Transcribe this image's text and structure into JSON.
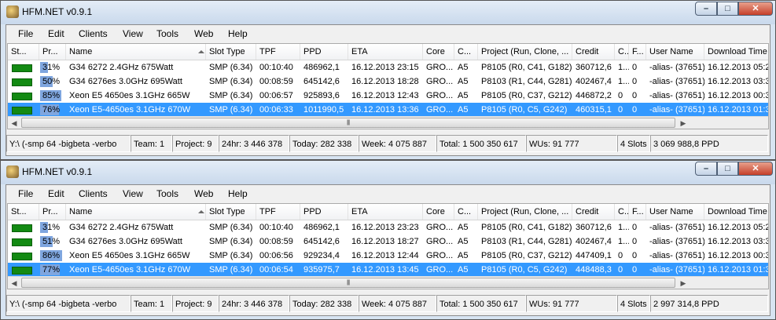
{
  "windows": [
    {
      "title": "HFM.NET v0.9.1",
      "menu": [
        "File",
        "Edit",
        "Clients",
        "View",
        "Tools",
        "Web",
        "Help"
      ],
      "columns": [
        "St...",
        "Pr...",
        "Name",
        "Slot Type",
        "TPF",
        "PPD",
        "ETA",
        "Core",
        "C...",
        "Project (Run, Clone, ...",
        "Credit",
        "C...",
        "F...",
        "User Name",
        "Download Time"
      ],
      "rows": [
        {
          "status": "running",
          "progress": 31,
          "progress_text": "31%",
          "name": "G34 6272 2.4GHz 675Watt",
          "slot_type": "SMP (6.34)",
          "tpf": "00:10:40",
          "ppd": "486962,1",
          "eta": "16.12.2013 23:15",
          "core": "GRO...",
          "c": "A5",
          "project": "P8105 (R0, C41, G182)",
          "credit": "360712,6",
          "c2": "1...",
          "f": "0",
          "user": "-alias- (37651)",
          "download": "16.12.2013 05:27",
          "selected": false
        },
        {
          "status": "running",
          "progress": 50,
          "progress_text": "50%",
          "name": "G34 6276es 3.0GHz 695Watt",
          "slot_type": "SMP (6.34)",
          "tpf": "00:08:59",
          "ppd": "645142,6",
          "eta": "16.12.2013 18:28",
          "core": "GRO...",
          "c": "A5",
          "project": "P8103 (R1, C44, G281)",
          "credit": "402467,4",
          "c2": "1...",
          "f": "0",
          "user": "-alias- (37651)",
          "download": "16.12.2013 03:31",
          "selected": false
        },
        {
          "status": "running",
          "progress": 85,
          "progress_text": "85%",
          "name": "Xeon E5 4650es 3.1GHz 665W",
          "slot_type": "SMP (6.34)",
          "tpf": "00:06:57",
          "ppd": "925893,6",
          "eta": "16.12.2013 12:43",
          "core": "GRO...",
          "c": "A5",
          "project": "P8105 (R0, C37, G212)",
          "credit": "446872,2",
          "c2": "0",
          "f": "0",
          "user": "-alias- (37651)",
          "download": "16.12.2013 00:34",
          "selected": false
        },
        {
          "status": "running",
          "progress": 76,
          "progress_text": "76%",
          "name": "Xeon E5-4650es 3.1GHz 670W",
          "slot_type": "SMP (6.34)",
          "tpf": "00:06:33",
          "ppd": "1011990,5",
          "eta": "16.12.2013 13:36",
          "core": "GRO...",
          "c": "A5",
          "project": "P8105 (R0, C5, G242)",
          "credit": "460315,1",
          "c2": "0",
          "f": "0",
          "user": "-alias- (37651)",
          "download": "16.12.2013 01:39",
          "selected": true
        }
      ],
      "status": {
        "path": "Y:\\ (-smp 64 -bigbeta -verbo",
        "team": "Team: 1",
        "project": "Project: 9",
        "h24": "24hr: 3 446 378",
        "today": "Today: 282 338",
        "week": "Week: 4 075 887",
        "total": "Total: 1 500 350 617",
        "wus": "WUs: 91 777",
        "slots": "4 Slots",
        "ppd": "3 069 988,8 PPD"
      }
    },
    {
      "title": "HFM.NET v0.9.1",
      "menu": [
        "File",
        "Edit",
        "Clients",
        "View",
        "Tools",
        "Web",
        "Help"
      ],
      "columns": [
        "St...",
        "Pr...",
        "Name",
        "Slot Type",
        "TPF",
        "PPD",
        "ETA",
        "Core",
        "C...",
        "Project (Run, Clone, ...",
        "Credit",
        "C...",
        "F...",
        "User Name",
        "Download Time"
      ],
      "rows": [
        {
          "status": "running",
          "progress": 31,
          "progress_text": "31%",
          "name": "G34 6272 2.4GHz 675Watt",
          "slot_type": "SMP (6.34)",
          "tpf": "00:10:40",
          "ppd": "486962,1",
          "eta": "16.12.2013 23:23",
          "core": "GRO...",
          "c": "A5",
          "project": "P8105 (R0, C41, G182)",
          "credit": "360712,6",
          "c2": "1...",
          "f": "0",
          "user": "-alias- (37651)",
          "download": "16.12.2013 05:27",
          "selected": false
        },
        {
          "status": "running",
          "progress": 51,
          "progress_text": "51%",
          "name": "G34 6276es 3.0GHz 695Watt",
          "slot_type": "SMP (6.34)",
          "tpf": "00:08:59",
          "ppd": "645142,6",
          "eta": "16.12.2013 18:27",
          "core": "GRO...",
          "c": "A5",
          "project": "P8103 (R1, C44, G281)",
          "credit": "402467,4",
          "c2": "1...",
          "f": "0",
          "user": "-alias- (37651)",
          "download": "16.12.2013 03:31",
          "selected": false
        },
        {
          "status": "running",
          "progress": 86,
          "progress_text": "86%",
          "name": "Xeon E5 4650es 3.1GHz 665W",
          "slot_type": "SMP (6.34)",
          "tpf": "00:06:56",
          "ppd": "929234,4",
          "eta": "16.12.2013 12:44",
          "core": "GRO...",
          "c": "A5",
          "project": "P8105 (R0, C37, G212)",
          "credit": "447409,1",
          "c2": "0",
          "f": "0",
          "user": "-alias- (37651)",
          "download": "16.12.2013 00:34",
          "selected": false
        },
        {
          "status": "running",
          "progress": 77,
          "progress_text": "77%",
          "name": "Xeon E5-4650es 3.1GHz 670W",
          "slot_type": "SMP (6.34)",
          "tpf": "00:06:54",
          "ppd": "935975,7",
          "eta": "16.12.2013 13:45",
          "core": "GRO...",
          "c": "A5",
          "project": "P8105 (R0, C5, G242)",
          "credit": "448488,3",
          "c2": "0",
          "f": "0",
          "user": "-alias- (37651)",
          "download": "16.12.2013 01:39",
          "selected": true
        }
      ],
      "status": {
        "path": "Y:\\ (-smp 64 -bigbeta -verbo",
        "team": "Team: 1",
        "project": "Project: 9",
        "h24": "24hr: 3 446 378",
        "today": "Today: 282 338",
        "week": "Week: 4 075 887",
        "total": "Total: 1 500 350 617",
        "wus": "WUs: 91 777",
        "slots": "4 Slots",
        "ppd": "2 997 314,8 PPD"
      }
    }
  ],
  "colors": {
    "selected_row": "#3399ff",
    "status_ok": "#138a13",
    "progress_fill": "#7fa6df"
  },
  "icons": {
    "app": "hfm-app-icon",
    "minimize": "minimize-icon",
    "maximize": "maximize-icon",
    "close": "close-icon"
  }
}
